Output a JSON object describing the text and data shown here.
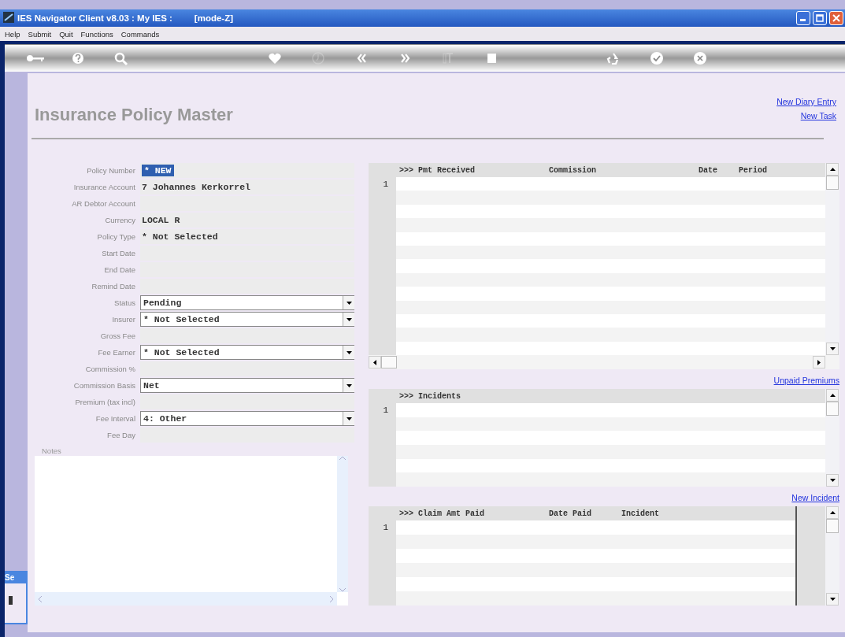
{
  "window": {
    "title": "IES Navigator Client v8.03 : My IES :",
    "mode": "[mode-Z]"
  },
  "menu": [
    "Help",
    "Submit",
    "Quit",
    "Functions",
    "Commands"
  ],
  "toolbar": [
    {
      "kind": "key",
      "disabled": false
    },
    {
      "kind": "help",
      "disabled": false
    },
    {
      "kind": "search",
      "disabled": false
    },
    {
      "kind": "heart",
      "disabled": false
    },
    {
      "kind": "clock",
      "disabled": true
    },
    {
      "kind": "back",
      "disabled": false
    },
    {
      "kind": "forward",
      "disabled": false
    },
    {
      "kind": "text",
      "disabled": true
    },
    {
      "kind": "stop",
      "disabled": false
    },
    {
      "kind": "recycle",
      "disabled": false
    },
    {
      "kind": "check",
      "disabled": false
    },
    {
      "kind": "close",
      "disabled": false
    }
  ],
  "page": {
    "title": "Insurance Policy Master",
    "links": [
      "New Diary Entry",
      "New Task"
    ]
  },
  "form": [
    {
      "label": "Policy Number",
      "value": "* NEW",
      "kind": "text",
      "highlighted": true
    },
    {
      "label": "Insurance Account",
      "value": "7 Johannes Kerkorrel",
      "kind": "text",
      "highlighted": false
    },
    {
      "label": "AR Debtor Account",
      "kind": "text",
      "highlighted": false
    },
    {
      "label": "Currency",
      "value": "LOCAL R",
      "kind": "text",
      "highlighted": false
    },
    {
      "label": "Policy Type",
      "value": "* Not Selected",
      "kind": "text",
      "highlighted": false
    },
    {
      "label": "Start Date",
      "kind": "text",
      "highlighted": false
    },
    {
      "label": "End Date",
      "kind": "text",
      "highlighted": false
    },
    {
      "label": "Remind Date",
      "kind": "text",
      "highlighted": false
    },
    {
      "label": "Status",
      "value": "Pending",
      "kind": "select",
      "highlighted": false
    },
    {
      "label": "Insurer",
      "value": "* Not Selected",
      "kind": "select",
      "highlighted": false
    },
    {
      "label": "Gross Fee",
      "kind": "text",
      "highlighted": false
    },
    {
      "label": "Fee Earner",
      "value": "* Not Selected",
      "kind": "select",
      "highlighted": false
    },
    {
      "label": "Commission %",
      "kind": "text",
      "highlighted": false
    },
    {
      "label": "Commission Basis",
      "value": "Net",
      "kind": "select",
      "highlighted": false
    },
    {
      "label": "Premium (tax incl)",
      "kind": "text",
      "highlighted": false
    },
    {
      "label": "Fee Interval",
      "value": "4: Other",
      "kind": "select",
      "highlighted": false
    },
    {
      "label": "Fee Day",
      "kind": "text",
      "highlighted": false
    }
  ],
  "notes": {
    "label": "Notes"
  },
  "grids": [
    {
      "columns": [
        ">>> Pmt Received",
        "Commission",
        "Date",
        "Period"
      ],
      "row_number": "1",
      "link_below": "Unpaid Premiums"
    },
    {
      "columns": [
        ">>> Incidents"
      ],
      "row_number": "1",
      "link_below": "New Incident"
    },
    {
      "columns": [
        ">>> Claim Amt Paid",
        "Date Paid",
        "Incident"
      ],
      "row_number": "1"
    }
  ],
  "background_window": {
    "title": "Se"
  }
}
